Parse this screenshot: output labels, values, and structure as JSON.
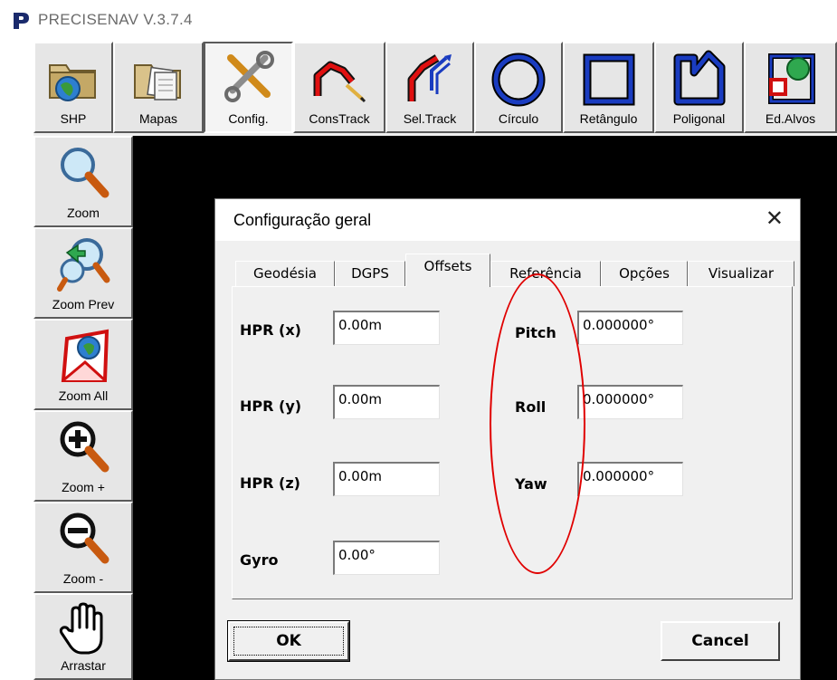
{
  "app": {
    "title": "PRECISENAV V.3.7.4",
    "logo_color": "#1a2a6c"
  },
  "toolbar": {
    "buttons": [
      {
        "label": "SHP",
        "icon": "folder-globe-icon"
      },
      {
        "label": "Mapas",
        "icon": "folder-documents-icon"
      },
      {
        "label": "Config.",
        "icon": "wrench-screwdriver-icon",
        "active": true
      },
      {
        "label": "ConsTrack",
        "icon": "construct-track-icon"
      },
      {
        "label": "Sel.Track",
        "icon": "select-track-icon"
      },
      {
        "label": "Círculo",
        "icon": "circle-icon"
      },
      {
        "label": "Retângulo",
        "icon": "rectangle-icon"
      },
      {
        "label": "Poligonal",
        "icon": "polygon-icon"
      },
      {
        "label": "Ed.Alvos",
        "icon": "edit-targets-icon"
      }
    ]
  },
  "sidebar": {
    "buttons": [
      {
        "label": "Zoom",
        "icon": "magnifier-icon"
      },
      {
        "label": "Zoom Prev",
        "icon": "zoom-previous-icon"
      },
      {
        "label": "Zoom All",
        "icon": "zoom-all-icon"
      },
      {
        "label": "Zoom +",
        "icon": "zoom-in-icon"
      },
      {
        "label": "Zoom -",
        "icon": "zoom-out-icon"
      },
      {
        "label": "Arrastar",
        "icon": "hand-pan-icon"
      }
    ]
  },
  "dialog": {
    "title": "Configuração geral",
    "close_symbol": "✕",
    "tabs": [
      "Geodésia",
      "DGPS",
      "Offsets",
      "Referência",
      "Opções",
      "Visualizar"
    ],
    "active_tab": "Offsets",
    "fields": {
      "hpr_x": {
        "label": "HPR (x)",
        "value": "0.00m"
      },
      "hpr_y": {
        "label": "HPR (y)",
        "value": "0.00m"
      },
      "hpr_z": {
        "label": "HPR (z)",
        "value": "0.00m"
      },
      "gyro": {
        "label": "Gyro",
        "value": "0.00°"
      },
      "pitch": {
        "label": "Pitch",
        "value": "0.000000°"
      },
      "roll": {
        "label": "Roll",
        "value": "0.000000°"
      },
      "yaw": {
        "label": "Yaw",
        "value": "0.000000°"
      }
    },
    "ok_label": "OK",
    "cancel_label": "Cancel"
  },
  "annotation": {
    "color": "#e00000"
  }
}
